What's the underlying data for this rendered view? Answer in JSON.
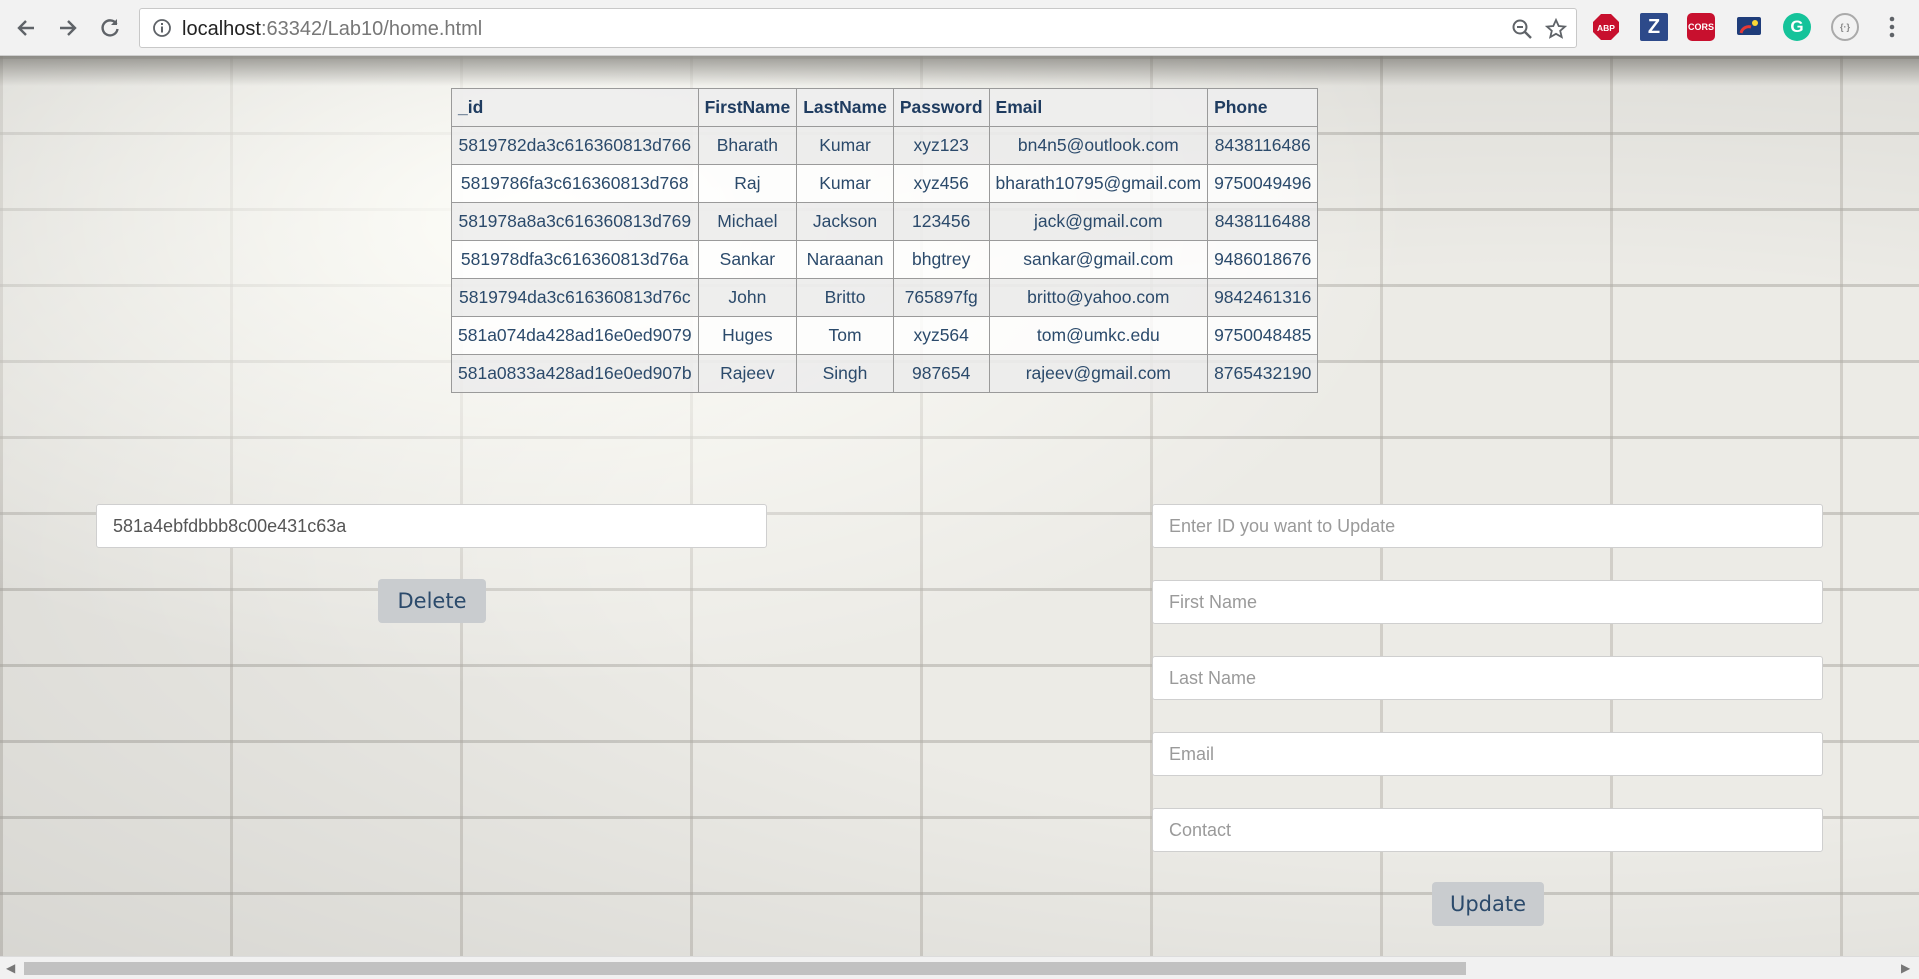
{
  "browser": {
    "url_host": "localhost",
    "url_port": ":63342",
    "url_path": "/Lab10/home.html",
    "extensions": [
      "abp-icon",
      "zotero-icon",
      "cors-icon",
      "cast-icon",
      "grammarly-icon",
      "json-icon"
    ],
    "ext_labels": {
      "abp": "ABP",
      "zotero": "Z",
      "cors": "CORS",
      "grammarly": "G",
      "json": "{·}"
    }
  },
  "table": {
    "headers": [
      "_id",
      "FirstName",
      "LastName",
      "Password",
      "Email",
      "Phone"
    ],
    "rows": [
      [
        "5819782da3c616360813d766",
        "Bharath",
        "Kumar",
        "xyz123",
        "bn4n5@outlook.com",
        "8438116486"
      ],
      [
        "5819786fa3c616360813d768",
        "Raj",
        "Kumar",
        "xyz456",
        "bharath10795@gmail.com",
        "9750049496"
      ],
      [
        "581978a8a3c616360813d769",
        "Michael",
        "Jackson",
        "123456",
        "jack@gmail.com",
        "8438116488"
      ],
      [
        "581978dfa3c616360813d76a",
        "Sankar",
        "Naraanan",
        "bhgtrey",
        "sankar@gmail.com",
        "9486018676"
      ],
      [
        "5819794da3c616360813d76c",
        "John",
        "Britto",
        "765897fg",
        "britto@yahoo.com",
        "9842461316"
      ],
      [
        "581a074da428ad16e0ed9079",
        "Huges",
        "Tom",
        "xyz564",
        "tom@umkc.edu",
        "9750048485"
      ],
      [
        "581a0833a428ad16e0ed907b",
        "Rajeev",
        "Singh",
        "987654",
        "rajeev@gmail.com",
        "8765432190"
      ]
    ]
  },
  "delete_form": {
    "id_value": "581a4ebfdbbb8c00e431c63a",
    "button_label": "Delete"
  },
  "update_form": {
    "id_placeholder": "Enter ID you want to Update",
    "first_name_placeholder": "First Name",
    "last_name_placeholder": "Last Name",
    "email_placeholder": "Email",
    "contact_placeholder": "Contact",
    "button_label": "Update"
  },
  "colors": {
    "table_text": "#2b4a6b",
    "button_bg": "#c9cccf"
  }
}
